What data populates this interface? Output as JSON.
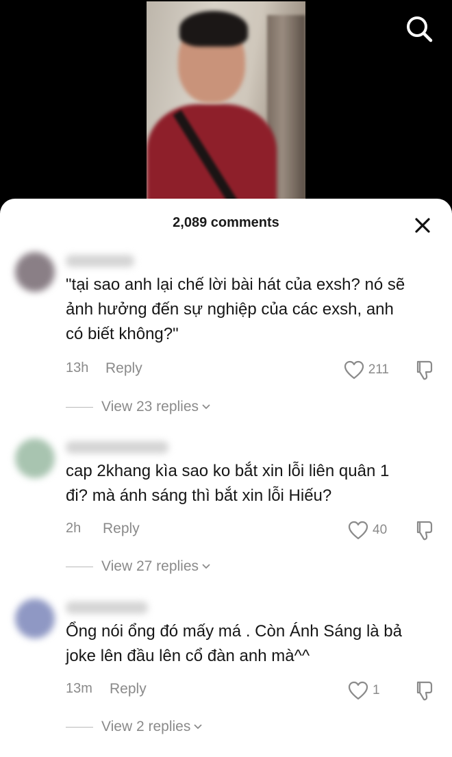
{
  "header": {
    "comments_count": "2,089 comments"
  },
  "icons": {
    "search": "search-icon",
    "close": "close-icon",
    "like": "heart-icon",
    "dislike": "thumbs-down-icon",
    "chevron": "chevron-down-icon"
  },
  "colors": {
    "sheet_bg": "#ffffff",
    "meta_gray": "#8a8a8a",
    "text_dark": "#161616"
  },
  "comments": [
    {
      "text_line1": "\"tại sao anh lại chế lời bài hát của exsh? nó sẽ",
      "text_line2": "ảnh hưởng đến sự nghiệp của các exsh, anh",
      "text_line3": "có biết không?\"",
      "time": "13h",
      "reply_label": "Reply",
      "likes": "211",
      "view_replies": "View 23 replies"
    },
    {
      "text_line1": "cap 2khang kìa sao ko bắt xin lỗi liên quân 1",
      "text_line2": "đi? mà ánh sáng thì bắt xin lỗi Hiếu?",
      "time": "2h",
      "reply_label": "Reply",
      "likes": "40",
      "view_replies": "View 27 replies"
    },
    {
      "text_line1": "Ổng nói ổng đó mấy má . Còn Ánh Sáng là bả",
      "text_line2": "joke lên đầu lên cổ đàn anh mà^^",
      "time": "13m",
      "reply_label": "Reply",
      "likes": "1",
      "view_replies": "View 2 replies"
    }
  ]
}
